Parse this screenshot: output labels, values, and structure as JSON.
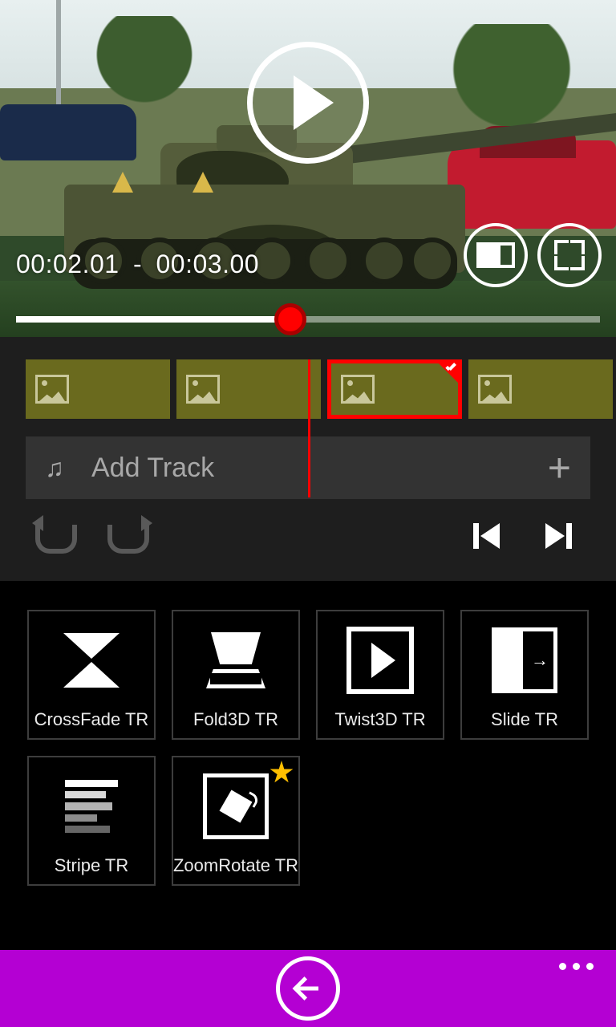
{
  "preview": {
    "time_start": "00:02.01",
    "time_end": "00:03.00",
    "progress_pct": 47
  },
  "timeline": {
    "clips": [
      {
        "selected": false
      },
      {
        "selected": false
      },
      {
        "selected": true
      },
      {
        "selected": false
      }
    ],
    "audio": {
      "label": "Add Track"
    }
  },
  "transitions": [
    {
      "id": "crossfade",
      "label": "CrossFade TR",
      "featured": false
    },
    {
      "id": "fold3d",
      "label": "Fold3D TR",
      "featured": false
    },
    {
      "id": "twist3d",
      "label": "Twist3D TR",
      "featured": false
    },
    {
      "id": "slide",
      "label": "Slide TR",
      "featured": false
    },
    {
      "id": "stripe",
      "label": "Stripe TR",
      "featured": false
    },
    {
      "id": "zoomrotate",
      "label": "ZoomRotate TR",
      "featured": true
    }
  ],
  "colors": {
    "accent": "#b400d3",
    "selection": "#ff0000",
    "clip": "#6a6a1e"
  }
}
